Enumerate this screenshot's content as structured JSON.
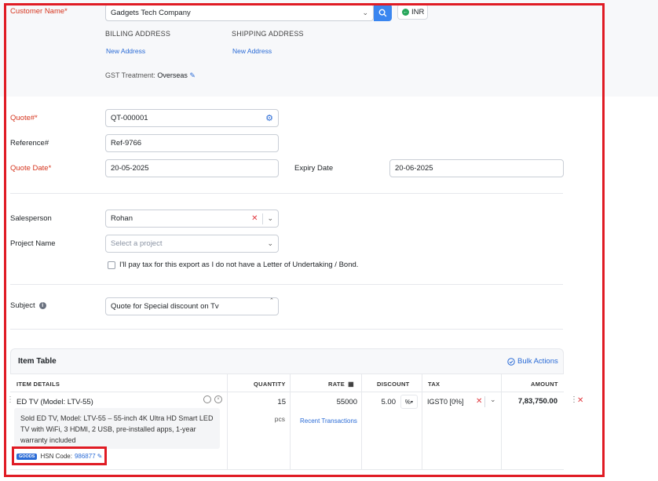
{
  "customer": {
    "label": "Customer Name*",
    "value": "Gadgets Tech Company",
    "currency": "INR",
    "billing_address_heading": "BILLING ADDRESS",
    "shipping_address_heading": "SHIPPING ADDRESS",
    "billing_new_address": "New Address",
    "shipping_new_address": "New Address",
    "gst_treatment_label": "GST Treatment:",
    "gst_treatment_value": "Overseas"
  },
  "quote": {
    "number_label": "Quote#*",
    "number_value": "QT-000001",
    "reference_label": "Reference#",
    "reference_value": "Ref-9766",
    "date_label": "Quote Date*",
    "date_value": "20-05-2025",
    "expiry_label": "Expiry Date",
    "expiry_value": "20-06-2025"
  },
  "sales": {
    "salesperson_label": "Salesperson",
    "salesperson_value": "Rohan",
    "project_label": "Project Name",
    "project_placeholder": "Select a project",
    "tax_checkbox_label": "I'll pay tax for this export as I do not have a Letter of Undertaking / Bond."
  },
  "subject": {
    "label": "Subject",
    "value": "Quote for Special discount on Tv"
  },
  "item_table": {
    "title": "Item Table",
    "bulk_actions": "Bulk Actions",
    "columns": [
      "ITEM DETAILS",
      "QUANTITY",
      "RATE",
      "DISCOUNT",
      "TAX",
      "AMOUNT"
    ],
    "rows": [
      {
        "name": "ED TV (Model: LTV-55)",
        "description": "Sold ED TV, Model: LTV-55 – 55-inch 4K Ultra HD Smart LED TV with WiFi, 3 HDMI, 2 USB, pre-installed apps, 1-year warranty included",
        "type_badge": "GOODS",
        "hsn_label": "HSN Code:",
        "hsn_value": "986877",
        "quantity": "15",
        "unit": "pcs",
        "rate": "55000",
        "recent_transactions": "Recent Transactions",
        "discount": "5.00",
        "discount_type": "%",
        "tax": "IGST0 [0%]",
        "amount": "7,83,750.00"
      }
    ]
  },
  "colors": {
    "accent": "#2a6bd6",
    "required": "#d6361f",
    "highlight_border": "#e01b24",
    "currency_green": "#26a65b"
  }
}
